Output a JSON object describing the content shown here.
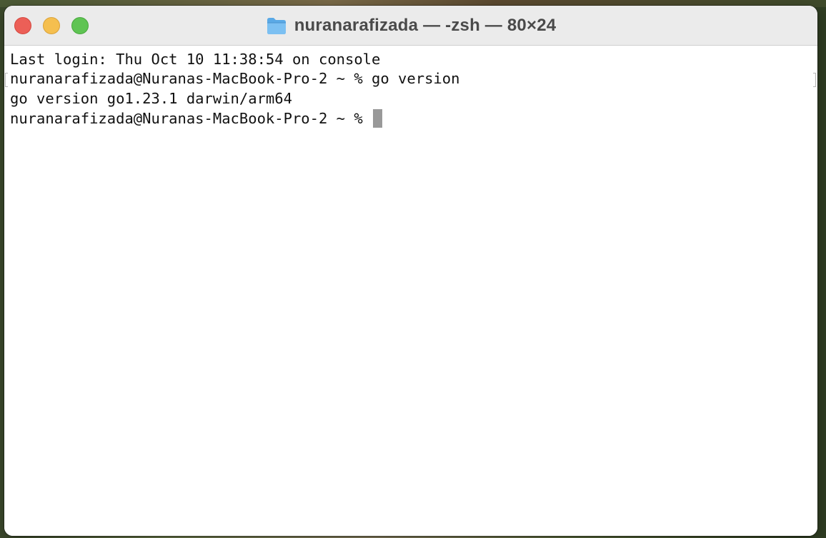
{
  "window": {
    "title": "nuranarafizada — -zsh — 80×24",
    "title_icon": "folder-icon"
  },
  "traffic_lights": {
    "close_color": "#ec5f57",
    "minimize_color": "#f5bf4f",
    "zoom_color": "#5fc453"
  },
  "terminal": {
    "lines": [
      "Last login: Thu Oct 10 11:38:54 on console",
      "nuranarafizada@Nuranas-MacBook-Pro-2 ~ % go version",
      "go version go1.23.1 darwin/arm64",
      "nuranarafizada@Nuranas-MacBook-Pro-2 ~ % "
    ],
    "cursor_color": "#999999"
  }
}
